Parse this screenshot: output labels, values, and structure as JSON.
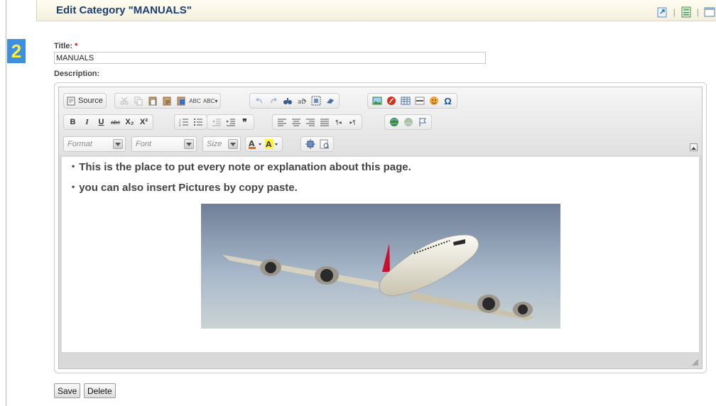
{
  "page": {
    "step_number": "2",
    "title": "Edit Category \"MANUALS\""
  },
  "header_actions": [
    "export-icon",
    "calculator-icon",
    "window-icon"
  ],
  "form": {
    "title_label": "Title:",
    "required_mark": "*",
    "title_value": "MANUALS",
    "description_label": "Description:"
  },
  "editor": {
    "source_label": "Source",
    "format_placeholder": "Format",
    "font_placeholder": "Font",
    "size_placeholder": "Size",
    "bold": "B",
    "italic": "I",
    "underline": "U",
    "strike": "abc",
    "subscript": "X₂",
    "superscript": "X²",
    "quote": "❞",
    "content": {
      "lines": [
        "This is the place to put every note or explanation about this page.",
        "you can also insert Pictures by copy paste."
      ],
      "image": "airplane-photo"
    }
  },
  "actions": {
    "save_label": "Save",
    "delete_label": "Delete"
  },
  "colors": {
    "badge_bg": "#3f8fe0",
    "badge_text": "#ffef3a",
    "title_text": "#1b3f74",
    "header_bg": "#f4f0dd"
  }
}
